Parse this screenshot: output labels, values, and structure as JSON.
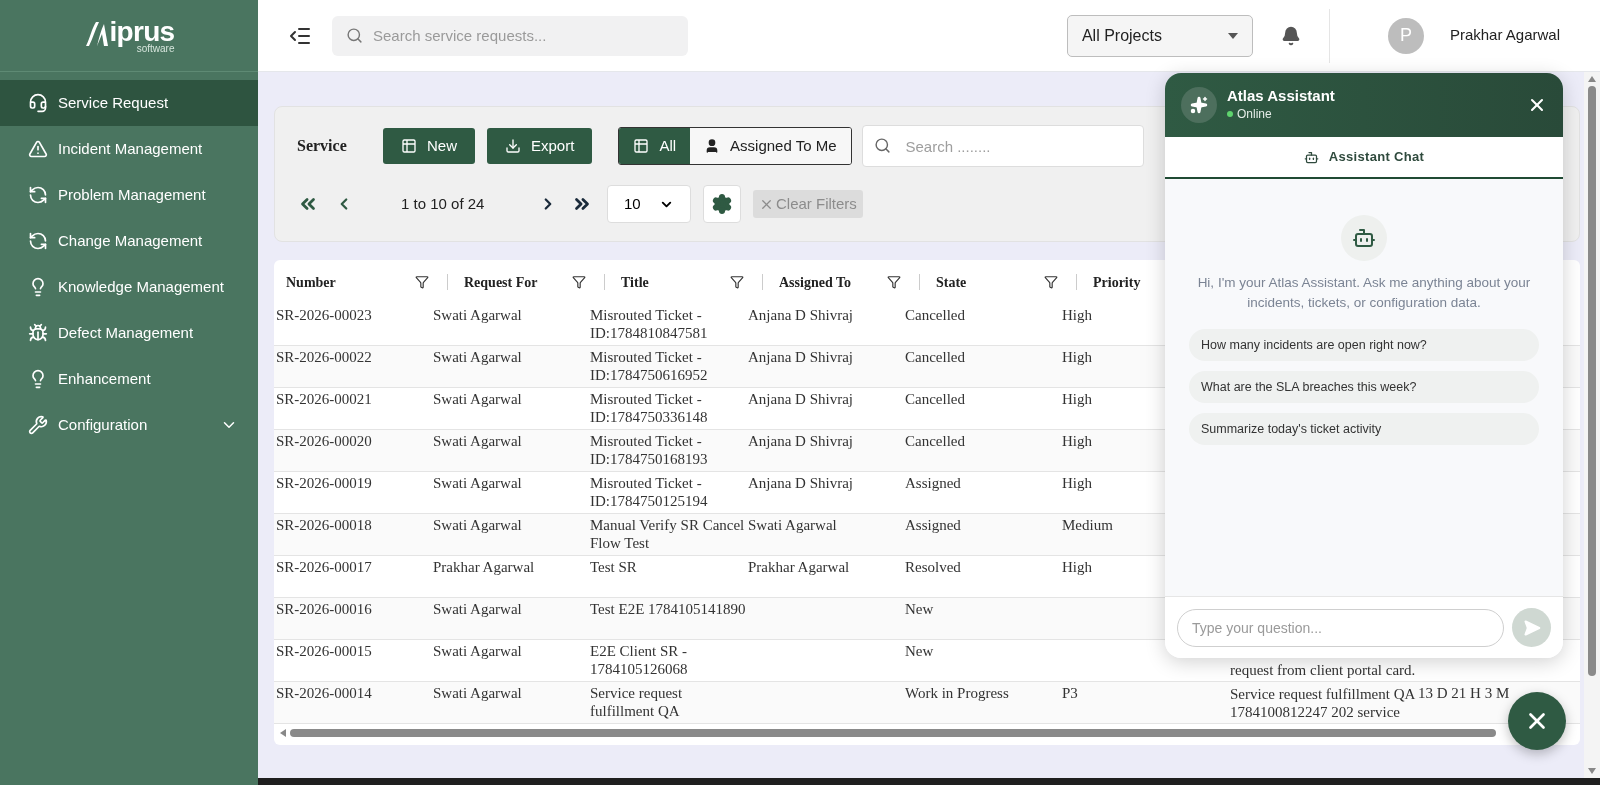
{
  "sidebar": {
    "logo": {
      "name": "iprus",
      "tagline": "software"
    },
    "items": [
      {
        "label": "Service Request",
        "selected": true
      },
      {
        "label": "Incident Management",
        "selected": false
      },
      {
        "label": "Problem Management",
        "selected": false
      },
      {
        "label": "Change Management",
        "selected": false
      },
      {
        "label": "Knowledge Management",
        "selected": false
      },
      {
        "label": "Defect Management",
        "selected": false
      },
      {
        "label": "Enhancement",
        "selected": false
      },
      {
        "label": "Configuration",
        "selected": false,
        "expanded": false
      }
    ]
  },
  "topbar": {
    "search": {
      "placeholder": "Search service requests..."
    },
    "project_select": {
      "value": "All Projects"
    },
    "user": {
      "initial": "P",
      "name": "Prakhar Agarwal"
    }
  },
  "toolbar": {
    "title": "Service",
    "buttons": [
      "New",
      "Export"
    ],
    "view_toggle": [
      {
        "label": "All",
        "selected": true
      },
      {
        "label": "Assigned To Me",
        "selected": false
      }
    ],
    "search": {
      "placeholder": "Search ........"
    },
    "pagination": {
      "range": "1 to 10 of 24",
      "page_size": "10"
    },
    "clear_filters": {
      "label": "Clear Filters",
      "disabled": true
    }
  },
  "table": {
    "columns": [
      "Number",
      "Request For",
      "Title",
      "Assigned To",
      "State",
      "Priority"
    ],
    "rows": [
      {
        "number": "SR-2026-00023",
        "request_for": "Swati Agarwal",
        "title": "Misrouted Ticket - ID:1784810847581",
        "assigned_to": "Anjana D Shivraj",
        "state": "Cancelled",
        "priority": "High"
      },
      {
        "number": "SR-2026-00022",
        "request_for": "Swati Agarwal",
        "title": "Misrouted Ticket - ID:1784750616952",
        "assigned_to": "Anjana D Shivraj",
        "state": "Cancelled",
        "priority": "High"
      },
      {
        "number": "SR-2026-00021",
        "request_for": "Swati Agarwal",
        "title": "Misrouted Ticket - ID:1784750336148",
        "assigned_to": "Anjana D Shivraj",
        "state": "Cancelled",
        "priority": "High"
      },
      {
        "number": "SR-2026-00020",
        "request_for": "Swati Agarwal",
        "title": "Misrouted Ticket - ID:1784750168193",
        "assigned_to": "Anjana D Shivraj",
        "state": "Cancelled",
        "priority": "High"
      },
      {
        "number": "SR-2026-00019",
        "request_for": "Swati Agarwal",
        "title": "Misrouted Ticket - ID:1784750125194",
        "assigned_to": "Anjana D Shivraj",
        "state": "Assigned",
        "priority": "High"
      },
      {
        "number": "SR-2026-00018",
        "request_for": "Swati Agarwal",
        "title": "Manual Verify SR Cancel Flow Test",
        "assigned_to": "Swati Agarwal",
        "state": "Assigned",
        "priority": "Medium"
      },
      {
        "number": "SR-2026-00017",
        "request_for": "Prakhar Agarwal",
        "title": "Test SR",
        "assigned_to": "Prakhar Agarwal",
        "state": "Resolved",
        "priority": "High"
      },
      {
        "number": "SR-2026-00016",
        "request_for": "Swati Agarwal",
        "title": "Test E2E 1784105141890",
        "state": "New"
      },
      {
        "number": "SR-2026-00015",
        "request_for": "Swati Agarwal",
        "title": "E2E Client SR - 1784105126068",
        "state": "New",
        "column_7": "request from client portal card."
      },
      {
        "number": "SR-2026-00014",
        "request_for": "Swati Agarwal",
        "title": "Service request fulfillment QA",
        "state": "Work in Progress",
        "priority": "P3",
        "column_7": "Service request fulfillment QA 1784100812247 202 service",
        "column_8": "13 D 21 H 3 M"
      }
    ]
  },
  "chat": {
    "title": "Atlas Assistant",
    "status": "Online",
    "online": true,
    "tabs": [
      {
        "label": "Assistant Chat",
        "selected": true
      }
    ],
    "greeting": "Hi, I'm your Atlas Assistant. Ask me anything about your incidents, tickets, or configuration data.",
    "suggestions": [
      "How many incidents are open right now?",
      "What are the SLA breaches this week?",
      "Summarize today's ticket activity"
    ],
    "input": {
      "placeholder": "Type your question..."
    }
  }
}
